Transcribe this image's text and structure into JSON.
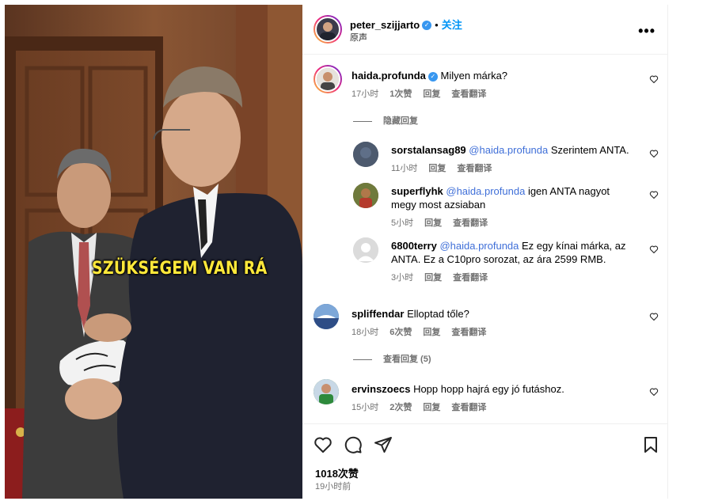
{
  "post": {
    "author": "peter_szijjarto",
    "follow_label": "关注",
    "separator": "•",
    "audio_label": "原声",
    "more_icon": "•••",
    "video_caption": "SZÜKSÉGEM VAN RÁ"
  },
  "comments": [
    {
      "username": "haida.profunda",
      "verified": true,
      "text": "Milyen márka?",
      "time": "17小时",
      "likes": "1次赞",
      "reply_label": "回复",
      "translate_label": "查看翻译",
      "toggle_label": "隐藏回复",
      "replies": [
        {
          "username": "sorstalansag89",
          "mention": "@haida.profunda",
          "text": "Szerintem ANTA.",
          "time": "11小时",
          "reply_label": "回复",
          "translate_label": "查看翻译"
        },
        {
          "username": "superflyhk",
          "mention": "@haida.profunda",
          "text": "igen ANTA nagyot megy most azsiaban",
          "time": "5小时",
          "reply_label": "回复",
          "translate_label": "查看翻译"
        },
        {
          "username": "6800terry",
          "mention": "@haida.profunda",
          "text": "Ez egy kínai márka, az ANTA. Ez a C10pro sorozat, az ára 2599 RMB.",
          "time": "3小时",
          "reply_label": "回复",
          "translate_label": "查看翻译"
        }
      ]
    },
    {
      "username": "spliffendar",
      "text": "Elloptad tőle?",
      "time": "18小时",
      "likes": "6次赞",
      "reply_label": "回复",
      "translate_label": "查看翻译",
      "toggle_label": "查看回复 (5)"
    },
    {
      "username": "ervinszoecs",
      "text": "Hopp hopp hajrá egy jó futáshoz.",
      "time": "15小时",
      "likes": "2次赞",
      "reply_label": "回复",
      "translate_label": "查看翻译"
    }
  ],
  "footer": {
    "likes": "1018次赞",
    "posted": "19小时前"
  },
  "icons": {
    "like": "heart-icon",
    "comment": "comment-icon",
    "share": "send-icon",
    "save": "bookmark-icon"
  },
  "colors": {
    "link": "#0095f6",
    "mention": "#00376b",
    "muted": "#737373",
    "caption": "#ffe83a"
  }
}
